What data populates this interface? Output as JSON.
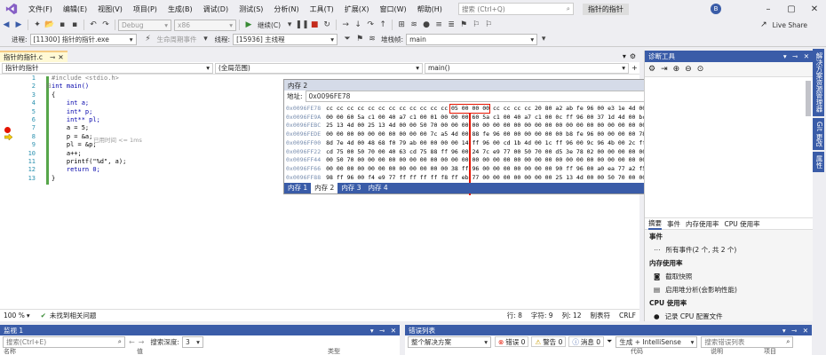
{
  "titlebar": {
    "menus": [
      "文件(F)",
      "编辑(E)",
      "视图(V)",
      "项目(P)",
      "生成(B)",
      "调试(D)",
      "测试(S)",
      "分析(N)",
      "工具(T)",
      "扩展(X)",
      "窗口(W)",
      "帮助(H)"
    ],
    "search_placeholder": "搜索 (Ctrl+Q)",
    "solution_name": "指针的指针",
    "avatar_letter": "B",
    "live_share": "Live Share"
  },
  "toolbar1": {
    "config": "Debug",
    "platform": "x86",
    "continue": "继续(C)"
  },
  "toolbar2": {
    "process_label": "进程:",
    "process": "[11300] 指针的指针.exe",
    "lifecycle": "生命周期事件",
    "thread_label": "线程:",
    "thread": "[15936] 主线程",
    "stack_label": "堆栈帧:",
    "stack": "main"
  },
  "editor": {
    "tab": "指针的指针.c",
    "nav_project": "指针的指针",
    "nav_scope": "(全局范围)",
    "nav_func": "main()",
    "lines": [
      {
        "n": "1",
        "code": "#include <stdio.h>"
      },
      {
        "n": "2",
        "code": "int main()"
      },
      {
        "n": "3",
        "code": "{"
      },
      {
        "n": "4",
        "code": "    int a;"
      },
      {
        "n": "5",
        "code": "    int* p;"
      },
      {
        "n": "6",
        "code": "    int** pl;"
      },
      {
        "n": "7",
        "code": "    a = 5;"
      },
      {
        "n": "8",
        "code": "    p = &a;"
      },
      {
        "n": "9",
        "code": "    pl = &p;"
      },
      {
        "n": "10",
        "code": "    a++;"
      },
      {
        "n": "11",
        "code": "    printf(\"%d\", a);"
      },
      {
        "n": "12",
        "code": "    return 0;"
      },
      {
        "n": "13",
        "code": "}"
      }
    ],
    "hint": "已用时间 <= 1ms",
    "zoom": "100 %",
    "status_ok": "未找到相关问题",
    "row": "行: 8",
    "col": "字符: 9",
    "colnum": "列: 12",
    "tabs": "制表符",
    "eol": "CRLF"
  },
  "memory": {
    "title": "内存 2",
    "addr_label": "地址:",
    "addr": "0x0096FE78",
    "cols_label": "列:",
    "cols": "自动",
    "rows": [
      {
        "a": "0x0096FE78",
        "h": "cc cc cc cc cc cc cc cc cc cc cc cc 05 00 00 00 cc cc cc cc 20 80 a2 ab fe 96 00 e3 1e 4d 00 01 00",
        "t": "????????????? ?  €?????.?.?"
      },
      {
        "a": "0x0096FE9A",
        "h": "00 00 60 5a c1 00 40 a7 c1 00 01 00 00 00 60 5a c1 00 40 a7 c1 00 0c ff 96 00 37 1d 4d 00 bc 81 a2 ab",
        "t": "..`Z?.@?.....`Z?.@?..?.7.M.???"
      },
      {
        "a": "0x0096FEBC",
        "h": "25 13 4d 00 25 13 4d 00 00 50 70 00 00 00 00 00 00 00 00 00 00 00 00 00 00 00 00 00 00 00 00 00 00 00",
        "t": "%.M.%.M..Pp......................"
      },
      {
        "a": "0x0096FEDE",
        "h": "00 00 00 00 00 00 00 00 00 00 7c a5 4d 00 88 fe 96 00 00 00 00 00 00 b8 fe 96 00 00 00 00 78 ff 96 00",
        "t": "..........|?M.??.....??....x.?."
      },
      {
        "a": "0x0096FF00",
        "h": "8d 7e 4d 00 48 68 f0 79 ab 00 00 00 00 14 ff 96 00 cd 1b 4d 00 1c ff 96 00 9c 96 4b 00 2c ff 96 00 59 63",
        "t": "?~M.Hh?y?.....?..?.M..?.??K.,?.Yc"
      },
      {
        "a": "0x0096FF22",
        "h": "cd 75 00 50 70 00 40 63 cd 75 88 ff 96 00 24 7c e9 77 00 50 70 00 d5 3e 78 02 00 00 00 00 00 00 00 00",
        "t": "?u.Pp.@c?u??.$|?w.Pp.?>x........."
      },
      {
        "a": "0x0096FF44",
        "h": "00 50 70 00 00 00 00 00 00 00 00 00 00 00 00 00 00 00 00 00 00 00 00 00 00 00 00 00 00 00 00 00 00 00",
        "t": ".Pp..............................."
      },
      {
        "a": "0x0096FF66",
        "h": "00 00 00 00 00 00 00 00 00 00 00 00 38 ff 96 00 00 00 00 00 00 00 90 ff 96 00 a0 ea 77 a2 f5 a2 14 75",
        "t": "............8?.......??.??w????.u"
      },
      {
        "a": "0x0096FF88",
        "h": "98 ff 96 00 f4 e9 77 ff ff ff ff f8 ff eb 77 00 00 00 00 00 00 00 25 13 4d 00 00 50 70 00 00 00 00 00",
        "t": "??.??w????.?w.....%.M..Pp....."
      }
    ],
    "tabs": [
      "内存 1",
      "内存 2",
      "内存 3",
      "内存 4"
    ]
  },
  "diagnostics": {
    "title": "诊断工具",
    "tabs": [
      "摘要",
      "事件",
      "内存使用率",
      "CPU 使用率"
    ],
    "events_header": "事件",
    "events_item": "所有事件(2 个, 共 2 个)",
    "mem_header": "内存使用率",
    "mem_item1": "截取快照",
    "mem_item2": "启用堆分析(会影响性能)",
    "cpu_header": "CPU 使用率",
    "cpu_item": "记录 CPU 配置文件"
  },
  "right_strip": [
    "解决方案资源管理器",
    "Git 更改",
    "属性"
  ],
  "watch": {
    "title": "监视 1",
    "search_placeholder": "搜索(Ctrl+E)",
    "depth_label": "搜索深度:",
    "depth": "3",
    "col_name": "名称",
    "col_value": "值",
    "col_type": "类型"
  },
  "errors": {
    "title": "错误列表",
    "scope": "整个解决方案",
    "errors": "错误 0",
    "warnings": "警告 0",
    "messages": "消息 0",
    "build": "生成 + IntelliSense",
    "search_placeholder": "搜索错误列表",
    "col_code": "代码",
    "col_desc": "说明",
    "col_project": "项目"
  },
  "colors": {
    "accent": "#3a5ca8",
    "highlight": "#e51400"
  }
}
